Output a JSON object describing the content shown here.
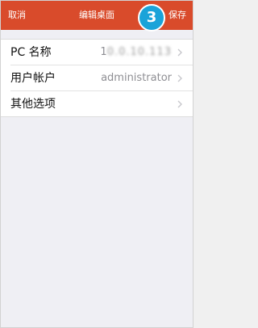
{
  "navbar": {
    "left_label": "取消",
    "title": "编辑桌面",
    "right_label": "保存",
    "step_number": "3",
    "background": "#d94b2b",
    "step_color": "#1aa3d9"
  },
  "rows": [
    {
      "label": "PC 名称",
      "value_prefix": "1",
      "value_redacted": "0.0.10.113",
      "chevron": "chevron-right-icon"
    },
    {
      "label": "用户帐户",
      "value": "administrator",
      "chevron": "chevron-right-icon"
    },
    {
      "label": "其他选项",
      "value": "",
      "chevron": "chevron-right-icon"
    }
  ]
}
